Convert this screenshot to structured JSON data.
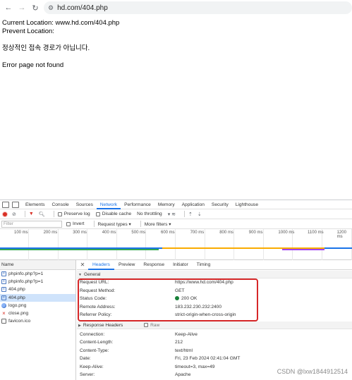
{
  "browser": {
    "back_icon": "←",
    "forward_icon": "→",
    "reload_icon": "↻",
    "tune_icon": "⚙",
    "url": "hd.com/404.php"
  },
  "page": {
    "current_location": "Current Location: www.hd.com/404.php",
    "prevent_location": "Prevent Location:",
    "korean_message": "정상적인 접속 경로가 아닙니다.",
    "error_message": "Error page not found"
  },
  "devtools": {
    "tabs": [
      "Elements",
      "Console",
      "Sources",
      "Network",
      "Performance",
      "Memory",
      "Application",
      "Security",
      "Lighthouse"
    ],
    "active_tab": "Network",
    "toolbar": {
      "preserve_log": "Preserve log",
      "disable_cache": "Disable cache",
      "throttling": "No throttling"
    },
    "filter": {
      "placeholder": "Filter",
      "invert": "Invert",
      "request_types": "Request types ▾",
      "more_filters": "More filters ▾"
    },
    "timeline_ticks": [
      "100 ms",
      "200 ms",
      "300 ms",
      "400 ms",
      "500 ms",
      "600 ms",
      "700 ms",
      "800 ms",
      "900 ms",
      "1000 ms",
      "1100 ms",
      "1200 ms"
    ],
    "name_header": "Name",
    "requests": [
      {
        "name": "phpinfo.php?p=1",
        "icon": "doc"
      },
      {
        "name": "phpinfo.php?p=1",
        "icon": "doc"
      },
      {
        "name": "404.php",
        "icon": "doc"
      },
      {
        "name": "404.php",
        "icon": "doc"
      },
      {
        "name": "logo.png",
        "icon": "img"
      },
      {
        "name": "close.png",
        "icon": "error"
      },
      {
        "name": "favicon.ico",
        "icon": "plain"
      }
    ],
    "selected_request_index": 3,
    "detail_tabs": [
      "Headers",
      "Preview",
      "Response",
      "Initiator",
      "Timing"
    ],
    "active_detail_tab": "Headers",
    "general": {
      "title": "General",
      "rows": [
        {
          "key": "Request URL:",
          "value": "https://www.hd.com/404.php"
        },
        {
          "key": "Request Method:",
          "value": "GET"
        },
        {
          "key": "Status Code:",
          "value": "200 OK"
        },
        {
          "key": "Remote Address:",
          "value": "183.232.230.232:2400"
        },
        {
          "key": "Referrer Policy:",
          "value": "strict-origin-when-cross-origin"
        }
      ]
    },
    "response_headers": {
      "title": "Response Headers",
      "raw_label": "Raw",
      "rows": [
        {
          "key": "Connection:",
          "value": "Keep-Alive"
        },
        {
          "key": "Content-Length:",
          "value": "212"
        },
        {
          "key": "Content-Type:",
          "value": "text/html"
        },
        {
          "key": "Date:",
          "value": "Fri, 23 Feb 2024 02:41:04 GMT"
        },
        {
          "key": "Keep-Alive:",
          "value": "timeout=3, max=49"
        },
        {
          "key": "Server:",
          "value": "Apache"
        }
      ]
    }
  },
  "watermark": "CSDN @lxw1844912514",
  "colors": {
    "accent": "#1a73e8",
    "highlight_box": "#d62728",
    "status_ok": "#188038",
    "record": "#d93025"
  }
}
